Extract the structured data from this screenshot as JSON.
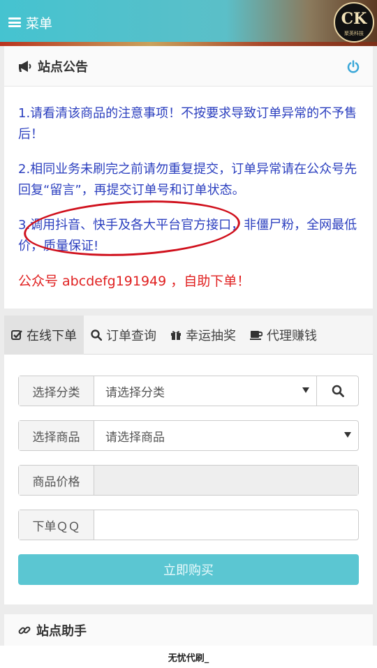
{
  "header": {
    "menu_label": "菜单",
    "logo_mark": "CK",
    "logo_sub": "聚英科技"
  },
  "notice": {
    "title": "站点公告",
    "items": [
      "1.请看清该商品的注意事项！不按要求导致订单异常的不予售后！",
      "2.相同业务未刷完之前请勿重复提交，订单异常请在公众号先回复“留言”，再提交订单号和订单状态。",
      "3.调用抖音、快手及各大平台官方接口，非僵尸粉，全网最低价，质量保证!"
    ],
    "highlight": "公众号 abcdefg191949 ，自助下单！"
  },
  "tabs": [
    {
      "label": "在线下单",
      "icon": "checkbox-icon"
    },
    {
      "label": "订单查询",
      "icon": "search-icon"
    },
    {
      "label": "幸运抽奖",
      "icon": "gift-icon"
    },
    {
      "label": "代理赚钱",
      "icon": "coffee-icon"
    }
  ],
  "form": {
    "category_label": "选择分类",
    "category_value": "请选择分类",
    "product_label": "选择商品",
    "product_value": "请选择商品",
    "price_label": "商品价格",
    "price_value": "",
    "qq_label": "下单ＱＱ",
    "qq_value": "",
    "buy_label": "立即购买"
  },
  "helper": {
    "title": "站点助手"
  },
  "footer": {
    "text": "无忧代刷_"
  },
  "colors": {
    "accent": "#5bc6d2",
    "notice_text": "#2b3fbf",
    "highlight": "#e02020"
  }
}
